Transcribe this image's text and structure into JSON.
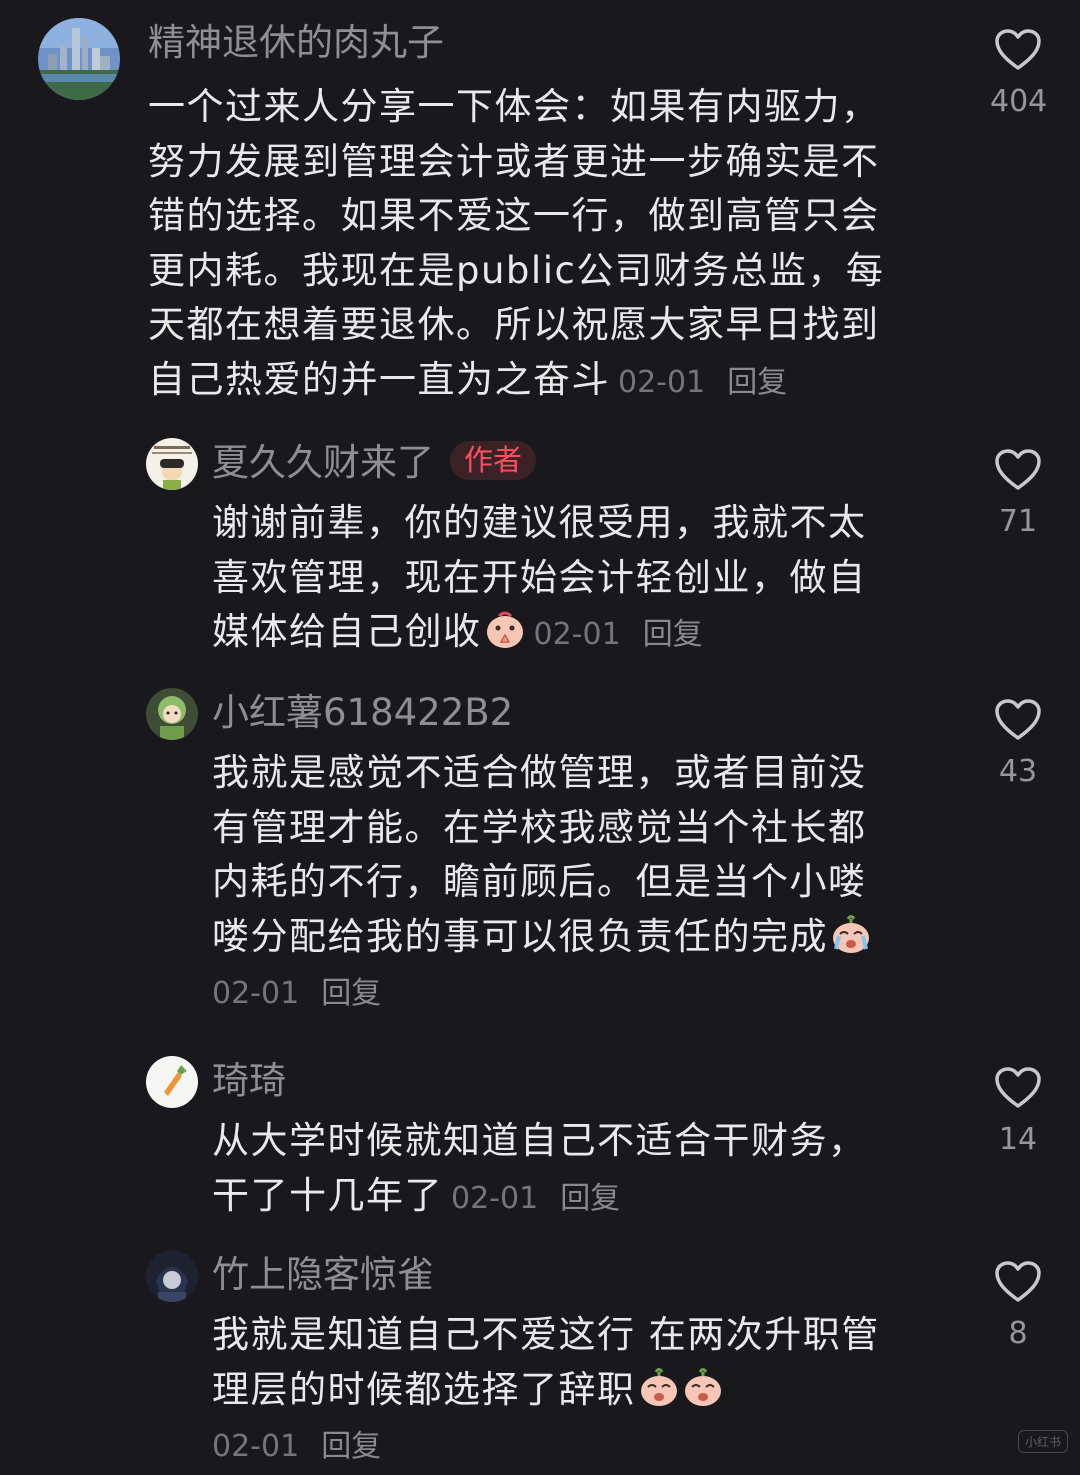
{
  "comments": [
    {
      "user": "精神退休的肉丸子",
      "lines": [
        "一个过来人分享一下体会：如果有内驱力，",
        "努力发展到管理会计或者更进一步确实是不",
        "错的选择。如果不爱这一行，做到高管只会",
        "更内耗。我现在是public公司财务总监，每",
        "天都在想着要退休。所以祝愿大家早日找到",
        "自己热爱的并一直为之奋斗"
      ],
      "date": "02-01",
      "reply": "回复",
      "likes": "404"
    },
    {
      "user": "夏久久财来了",
      "badge": "作者",
      "lines": [
        "谢谢前辈，你的建议很受用，我就不太",
        "喜欢管理，现在开始会计轻创业，做自",
        "媒体给自己创收"
      ],
      "date": "02-01",
      "reply": "回复",
      "likes": "71"
    },
    {
      "user": "小红薯618422B2",
      "lines": [
        "我就是感觉不适合做管理，或者目前没",
        "有管理才能。在学校我感觉当个社长都",
        "内耗的不行，瞻前顾后。但是当个小喽",
        "喽分配给我的事可以很负责任的完成"
      ],
      "date": "02-01",
      "reply": "回复",
      "likes": "43"
    },
    {
      "user": "琦琦",
      "lines": [
        "从大学时候就知道自己不适合干财务，",
        "干了十几年了"
      ],
      "date": "02-01",
      "reply": "回复",
      "likes": "14"
    },
    {
      "user": "竹上隐客惊雀",
      "lines": [
        "我就是知道自己不爱这行 在两次升职管",
        "理层的时候都选择了辞职"
      ],
      "date": "02-01",
      "reply": "回复",
      "likes": "8"
    }
  ],
  "icons": {
    "like": "heart-outline-icon",
    "emoji_pray": "pray-emoji-icon",
    "emoji_cry": "crying-emoji-icon"
  },
  "colors": {
    "background": "#19181d",
    "text": "#e9e8ec",
    "muted": "#8f8e93",
    "author_badge": "#ff4d5e"
  },
  "watermark": "小红书"
}
